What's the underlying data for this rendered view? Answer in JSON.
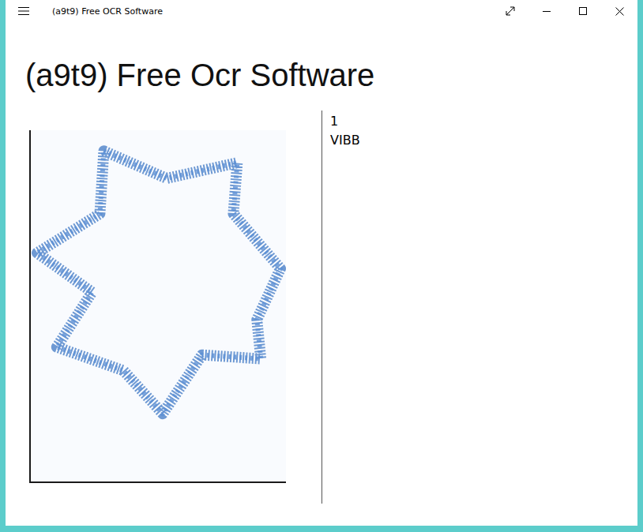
{
  "window": {
    "title": "(a9t9) Free OCR Software"
  },
  "page": {
    "heading": "(a9t9) Free Ocr Software"
  },
  "result": {
    "lines": [
      "1",
      "VIBB"
    ]
  }
}
